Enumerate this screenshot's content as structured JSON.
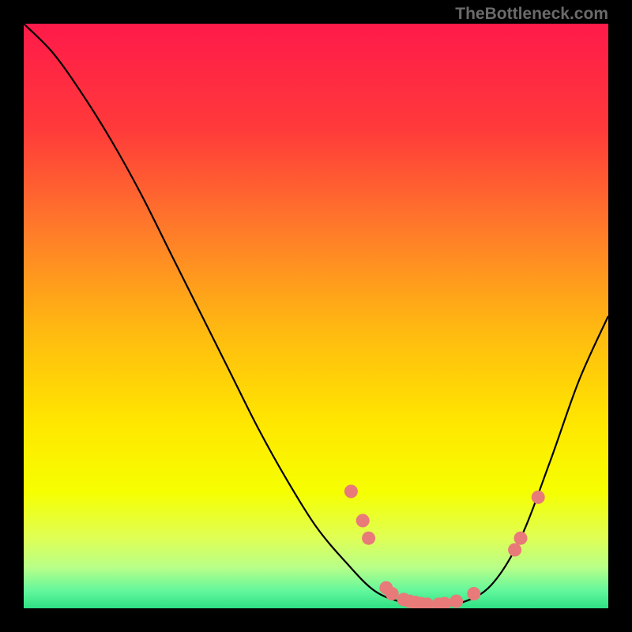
{
  "watermark": "TheBottleneck.com",
  "chart_data": {
    "type": "line",
    "title": "",
    "xlabel": "",
    "ylabel": "",
    "xlim": [
      0,
      100
    ],
    "ylim": [
      0,
      100
    ],
    "curve": [
      {
        "x": 0,
        "y": 100
      },
      {
        "x": 5,
        "y": 95
      },
      {
        "x": 10,
        "y": 88
      },
      {
        "x": 15,
        "y": 80
      },
      {
        "x": 20,
        "y": 71
      },
      {
        "x": 25,
        "y": 61
      },
      {
        "x": 30,
        "y": 51
      },
      {
        "x": 35,
        "y": 41
      },
      {
        "x": 40,
        "y": 31
      },
      {
        "x": 45,
        "y": 22
      },
      {
        "x": 50,
        "y": 14
      },
      {
        "x": 55,
        "y": 8
      },
      {
        "x": 60,
        "y": 3
      },
      {
        "x": 65,
        "y": 1
      },
      {
        "x": 70,
        "y": 0.5
      },
      {
        "x": 75,
        "y": 1
      },
      {
        "x": 80,
        "y": 4
      },
      {
        "x": 85,
        "y": 12
      },
      {
        "x": 90,
        "y": 25
      },
      {
        "x": 95,
        "y": 39
      },
      {
        "x": 100,
        "y": 50
      }
    ],
    "markers": [
      {
        "x": 56,
        "y": 20
      },
      {
        "x": 58,
        "y": 15
      },
      {
        "x": 59,
        "y": 12
      },
      {
        "x": 62,
        "y": 3.5
      },
      {
        "x": 63,
        "y": 2.5
      },
      {
        "x": 65,
        "y": 1.5
      },
      {
        "x": 66,
        "y": 1.2
      },
      {
        "x": 67,
        "y": 1.0
      },
      {
        "x": 68,
        "y": 0.8
      },
      {
        "x": 69,
        "y": 0.7
      },
      {
        "x": 71,
        "y": 0.7
      },
      {
        "x": 72,
        "y": 0.8
      },
      {
        "x": 74,
        "y": 1.2
      },
      {
        "x": 77,
        "y": 2.5
      },
      {
        "x": 84,
        "y": 10
      },
      {
        "x": 85,
        "y": 12
      },
      {
        "x": 88,
        "y": 19
      }
    ],
    "gradient_stops": [
      {
        "offset": 0,
        "color": "#ff1a4a"
      },
      {
        "offset": 18,
        "color": "#ff3a3a"
      },
      {
        "offset": 35,
        "color": "#ff7a2a"
      },
      {
        "offset": 52,
        "color": "#ffb811"
      },
      {
        "offset": 68,
        "color": "#ffe600"
      },
      {
        "offset": 80,
        "color": "#f6ff00"
      },
      {
        "offset": 88,
        "color": "#dfff55"
      },
      {
        "offset": 93,
        "color": "#b8ff88"
      },
      {
        "offset": 97,
        "color": "#63f79c"
      },
      {
        "offset": 100,
        "color": "#2ee084"
      }
    ],
    "marker_color": "#e87a7a",
    "curve_color": "#000000"
  }
}
